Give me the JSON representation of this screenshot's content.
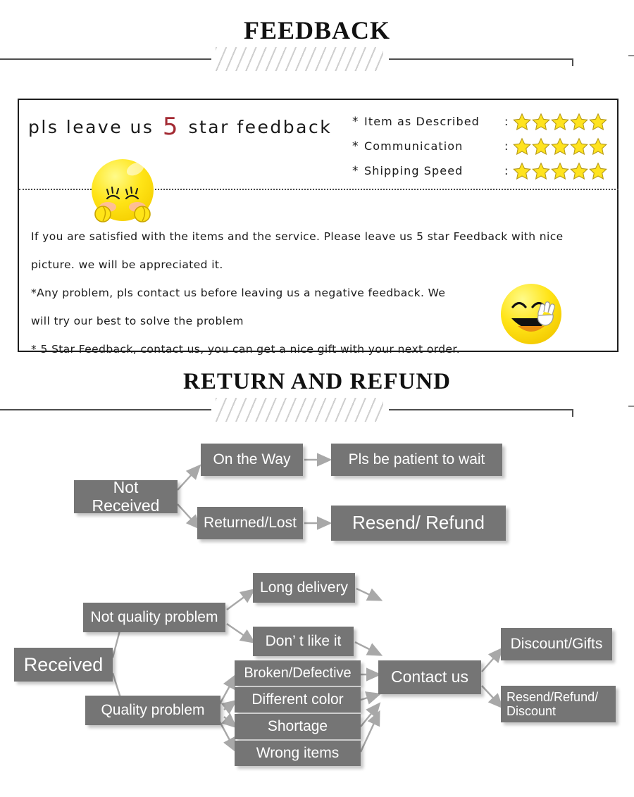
{
  "sections": {
    "feedback": {
      "title": "FEEDBACK"
    },
    "return": {
      "title": "RETURN  AND  REFUND"
    }
  },
  "feedback_panel": {
    "headline": {
      "before": "pls leave us",
      "highlight": "5",
      "after": "star feedback"
    },
    "highlight_color": "#a32a33",
    "ratings": [
      {
        "bullet": "*",
        "label": "Item as Described",
        "colon": ":",
        "stars": 5
      },
      {
        "bullet": "*",
        "label": "Communication",
        "colon": ":",
        "stars": 5
      },
      {
        "bullet": "*",
        "label": "Shipping Speed",
        "colon": ":",
        "stars": 5
      }
    ],
    "star_color": "#ffe31f",
    "star_outline": "#b59a1a",
    "body_lines": [
      "If you are satisfied with the items and the service. Please leave us 5 star Feedback with nice",
      "picture. we will be appreciated it.",
      "*Any problem, pls contact us before leaving us a negative feedback. We",
      "will try our best to solve  the problem",
      "* 5 Star Feedback, contact us, you can get a nice gift with your next order."
    ],
    "emoji_shy": "shy-smiley-emoji",
    "emoji_peace": "peace-sign-smiley-emoji"
  },
  "flow_not_received": {
    "root": "Not Received",
    "branches": [
      {
        "condition": "On the Way",
        "result": "Pls be patient to wait"
      },
      {
        "condition": "Returned/Lost",
        "result": "Resend/ Refund"
      }
    ]
  },
  "flow_received": {
    "root": "Received",
    "not_quality": "Not quality problem",
    "quality": "Quality problem",
    "not_quality_items": [
      "Long delivery",
      "Don’ t like it"
    ],
    "quality_items": [
      "Broken/Defective",
      "Different color",
      "Shortage",
      "Wrong items"
    ],
    "contact": "Contact us",
    "outcomes": [
      "Discount/Gifts",
      "Resend/Refund/\nDiscount"
    ]
  },
  "colors": {
    "node_fill": "#757575",
    "node_text": "#ffffff",
    "arrow": "#a8a8a8",
    "rule": "#4e4e4e",
    "panel_border": "#1d1d1d"
  }
}
